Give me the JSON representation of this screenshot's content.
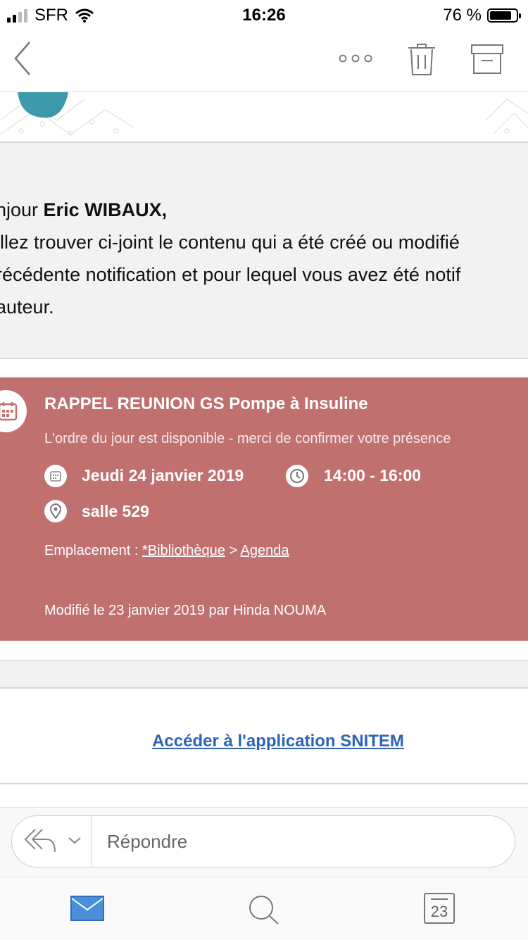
{
  "status_bar": {
    "carrier": "SFR",
    "time": "16:26",
    "battery": "76 %"
  },
  "nav": {
    "icons": [
      "back-chevron-icon",
      "more-icon",
      "trash-icon",
      "archive-icon"
    ]
  },
  "greeting": {
    "line1_prefix": "njour ",
    "line1_name": "Eric WIBAUX,",
    "line2": "illez trouver ci-joint le contenu qui a été créé ou modifié",
    "line3": "récédente notification et pour lequel vous avez été notif",
    "line4": " auteur."
  },
  "event_card": {
    "title": "RAPPEL REUNION GS Pompe à Insuline",
    "subtitle": "L'ordre du jour est disponible - merci de confirmer votre présence",
    "date": "Jeudi 24 janvier 2019",
    "time": "14:00 - 16:00",
    "room": "salle 529",
    "location_label": "Emplacement : ",
    "location_link1": "*Bibliothèque",
    "location_sep": " > ",
    "location_link2": "Agenda",
    "modified": "Modifié le 23 janvier 2019 par Hinda NOUMA",
    "bg_color": "#c17070"
  },
  "access_link": "Accéder à l'application SNITEM",
  "reply": {
    "placeholder": "Répondre"
  },
  "tabbar": {
    "calendar_day": "23",
    "accent": "#4a8fd8"
  }
}
